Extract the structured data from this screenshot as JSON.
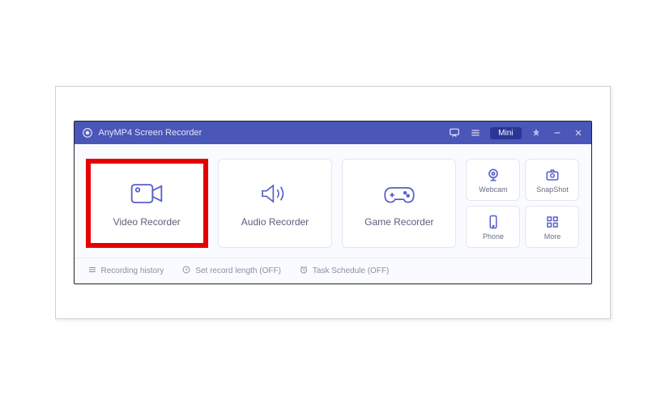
{
  "titlebar": {
    "app_name": "AnyMP4 Screen Recorder",
    "mini_label": "Mini"
  },
  "cards": {
    "video": {
      "label": "Video Recorder"
    },
    "audio": {
      "label": "Audio Recorder"
    },
    "game": {
      "label": "Game Recorder"
    }
  },
  "tools": {
    "webcam": {
      "label": "Webcam"
    },
    "snapshot": {
      "label": "SnapShot"
    },
    "phone": {
      "label": "Phone"
    },
    "more": {
      "label": "More"
    }
  },
  "footer": {
    "history": "Recording history",
    "length": "Set record length (OFF)",
    "schedule": "Task Schedule (OFF)"
  }
}
